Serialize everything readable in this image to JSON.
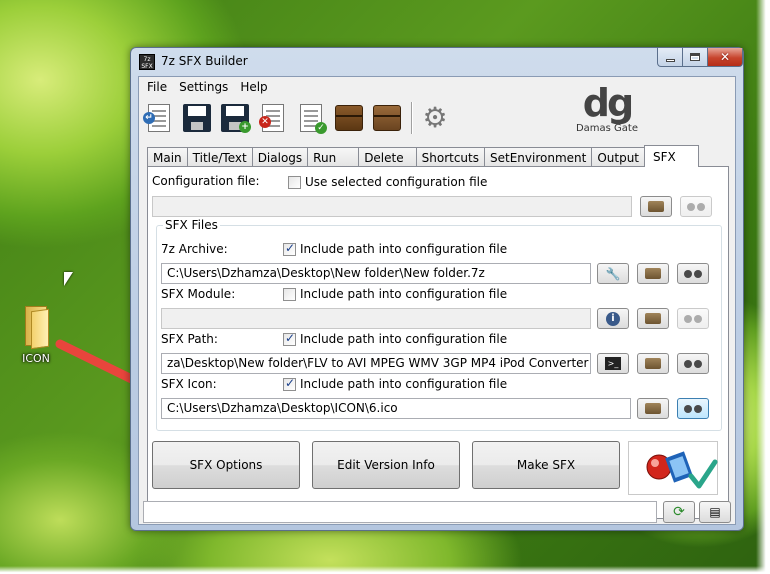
{
  "desktop": {
    "icon_label": "ICON"
  },
  "window": {
    "title": "7z SFX Builder",
    "app_icon_text": "7z SFX"
  },
  "menu": [
    "File",
    "Settings",
    "Help"
  ],
  "logo": {
    "mark": "dg",
    "name": "Damas Gate"
  },
  "tabs": [
    "Main",
    "Title/Text",
    "Dialogs",
    "Run",
    "Delete",
    "Shortcuts",
    "SetEnvironment",
    "Output",
    "SFX"
  ],
  "active_tab": "SFX",
  "sfx": {
    "config_label": "Configuration file:",
    "use_config_label": "Use selected configuration file",
    "use_config_checked": false,
    "config_value": "",
    "group_title": "SFX Files",
    "archive_label": "7z Archive:",
    "archive_include": "Include path into configuration file",
    "archive_include_checked": true,
    "archive_value": "C:\\Users\\Dzhamza\\Desktop\\New folder\\New folder.7z",
    "module_label": "SFX Module:",
    "module_include": "Include path into configuration file",
    "module_include_checked": false,
    "module_value": "",
    "path_label": "SFX Path:",
    "path_include": "Include path into configuration file",
    "path_include_checked": true,
    "path_value": "za\\Desktop\\New folder\\FLV to AVI MPEG WMV 3GP MP4 iPod Converter silent.exe",
    "icon_label": "SFX Icon:",
    "icon_include": "Include path into configuration file",
    "icon_include_checked": true,
    "icon_value": "C:\\Users\\Dzhamza\\Desktop\\ICON\\6.ico",
    "btn_options": "SFX Options",
    "btn_version": "Edit Version Info",
    "btn_make": "Make SFX"
  },
  "colors": {
    "arrow": "#e8453c",
    "accent": "#1a3f8a",
    "check_green": "#2aa58a"
  }
}
